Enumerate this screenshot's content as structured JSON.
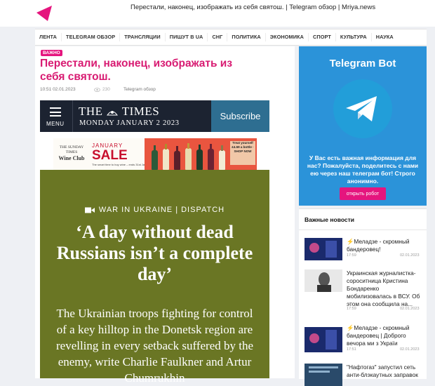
{
  "window": {
    "title": "Перестали, наконец, изображать из себя святош. | Telegram обзор | Mriya.news"
  },
  "colors": {
    "brand": "#e5157e",
    "telegram": "#2b93d9",
    "headline": "#d81b72",
    "times_bg": "#1c2331",
    "subscribe_bg": "#2e6e91",
    "article_bg": "#6a7624"
  },
  "nav": {
    "items": [
      "ЛЕНТА",
      "TELEGRAM ОБЗОР",
      "ТРАНСЛЯЦИИ",
      "ПИШУТ В UA",
      "СНГ",
      "ПОЛИТИКА",
      "ЭКОНОМИКА",
      "СПОРТ",
      "КУЛЬТУРА",
      "НАУКА"
    ]
  },
  "article": {
    "badge": "ВАЖНО",
    "title": "Перестали, наконец, изображать из себя святош.",
    "time": "10:51 02.01.2023",
    "views": "230",
    "category": "Telegram обзор",
    "times": {
      "menu_label": "MENU",
      "masthead_left": "THE",
      "masthead_right": "TIMES",
      "date": "MONDAY JANUARY 2 2023",
      "subscribe": "Subscribe"
    },
    "wine_ad": {
      "logo_top": "THE SUNDAY TIMES",
      "logo_name": "Wine Club",
      "sale_top": "JANUARY",
      "sale_big": "SALE",
      "sale_small": "The smart time to buy wine – ends 31st January",
      "promo": "Treat yourself £4.59 a bottle · SHOP NOW"
    },
    "image": {
      "kicker": "WAR IN UKRAINE | DISPATCH",
      "headline": "‘A day without dead Russians isn’t a complete day’",
      "standfirst": "The Ukrainian troops fighting for control of a key hilltop in the Donetsk region are revelling in every setback suffered by the enemy, write Charlie Faulkner and Artur Chumrukhin"
    }
  },
  "telegram": {
    "title": "Telegram Bot",
    "text": "У Вас есть важная информация для нас? Пожалуйста, поделитесь с нами ею через наш телеграм бот! Строго анонимно.",
    "button": "открыть робот"
  },
  "news": {
    "header": "Важные новости",
    "items": [
      {
        "title": "⚡Меладзе - скромный бандеровец!",
        "time": "17:59",
        "date": "02.01.2023"
      },
      {
        "title": "Украинская журналистка-сороситница Кристина Бондаренко мобилизовалась в ВСУ. Об этом она сообщила на...",
        "time": "17:59",
        "date": "02.01.2023"
      },
      {
        "title": "⚡Меладзе - скромный бандеровец | Доброго вечора ми з Україи",
        "time": "17:51",
        "date": "02.01.2023"
      },
      {
        "title": "\"Нафтогаз\" запустил сеть анти-блэкаутных заправок",
        "time": "",
        "date": ""
      }
    ]
  }
}
